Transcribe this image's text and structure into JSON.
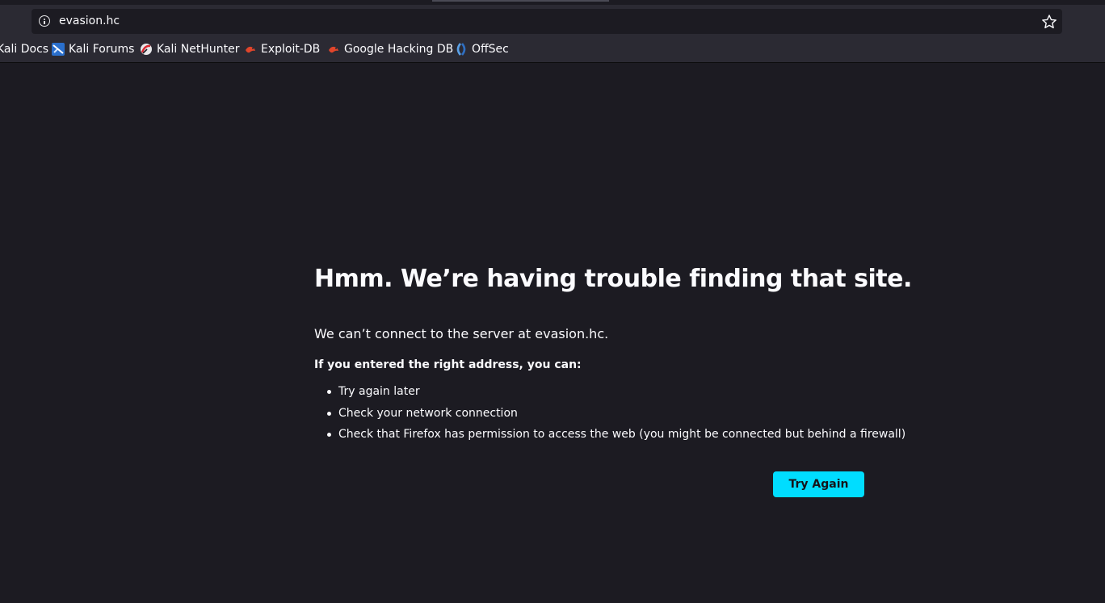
{
  "browser": {
    "url": "evasion.hc",
    "bookmarks": [
      {
        "label": "Kali Docs",
        "icon": "kali-dragon-icon"
      },
      {
        "label": "Kali Forums",
        "icon": "kali-forums-icon"
      },
      {
        "label": "Kali NetHunter",
        "icon": "nethunter-icon"
      },
      {
        "label": "Exploit-DB",
        "icon": "exploitdb-icon"
      },
      {
        "label": "Google Hacking DB",
        "icon": "ghdb-icon"
      },
      {
        "label": "OffSec",
        "icon": "offsec-icon"
      }
    ]
  },
  "error_page": {
    "title": "Hmm. We’re having trouble finding that site.",
    "description": "We can’t connect to the server at evasion.hc.",
    "subheading": "If you entered the right address, you can:",
    "suggestions": [
      "Try again later",
      "Check your network connection",
      "Check that Firefox has permission to access the web (you might be connected but behind a firewall)"
    ],
    "try_again_label": "Try Again"
  },
  "colors": {
    "page_background": "#1c1b22",
    "toolbar_background": "#2b2a33",
    "button_accent": "#00ddff",
    "text": "#fbfbfe"
  }
}
